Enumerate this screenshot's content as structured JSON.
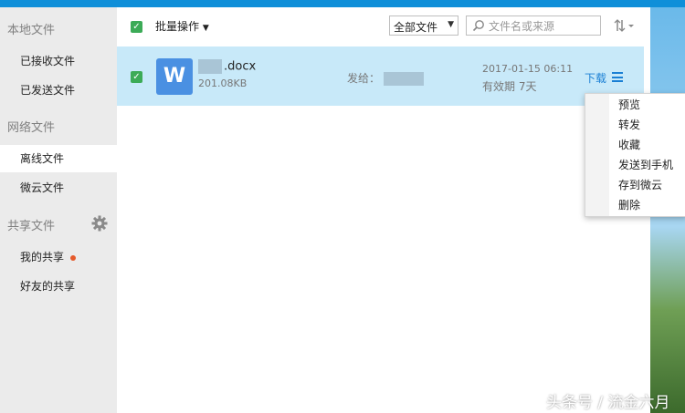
{
  "sidebar": {
    "sections": [
      {
        "title": "本地文件",
        "items": [
          {
            "label": "已接收文件"
          },
          {
            "label": "已发送文件"
          }
        ]
      },
      {
        "title": "网络文件",
        "items": [
          {
            "label": "离线文件"
          },
          {
            "label": "微云文件"
          }
        ]
      },
      {
        "title": "共享文件",
        "items": [
          {
            "label": "我的共享"
          },
          {
            "label": "好友的共享"
          }
        ]
      }
    ],
    "active_item": "离线文件",
    "settings_icon": "gear-icon"
  },
  "toolbar": {
    "batch_label": "批量操作",
    "filter_value": "全部文件",
    "search_placeholder": "文件名或来源",
    "sort_icon": "sort-icon"
  },
  "file_row": {
    "name_suffix": ".docx",
    "size": "201.08KB",
    "send_to_label": "发给：",
    "date": "2017-01-15 06:11",
    "expire": "有效期 7天",
    "download_label": "下载",
    "icon_letter": "W"
  },
  "context_menu": {
    "items": [
      {
        "label": "预览"
      },
      {
        "label": "转发"
      },
      {
        "label": "收藏"
      },
      {
        "label": "发送到手机"
      },
      {
        "label": "存到微云"
      },
      {
        "label": "删除"
      }
    ]
  },
  "watermark": "头条号 / 流金六月",
  "colors": {
    "accent": "#0f8fd9",
    "check": "#3cab57",
    "selected_row": "#c8e9f9",
    "link": "#1a7fd4",
    "badge": "#e55a2b"
  }
}
